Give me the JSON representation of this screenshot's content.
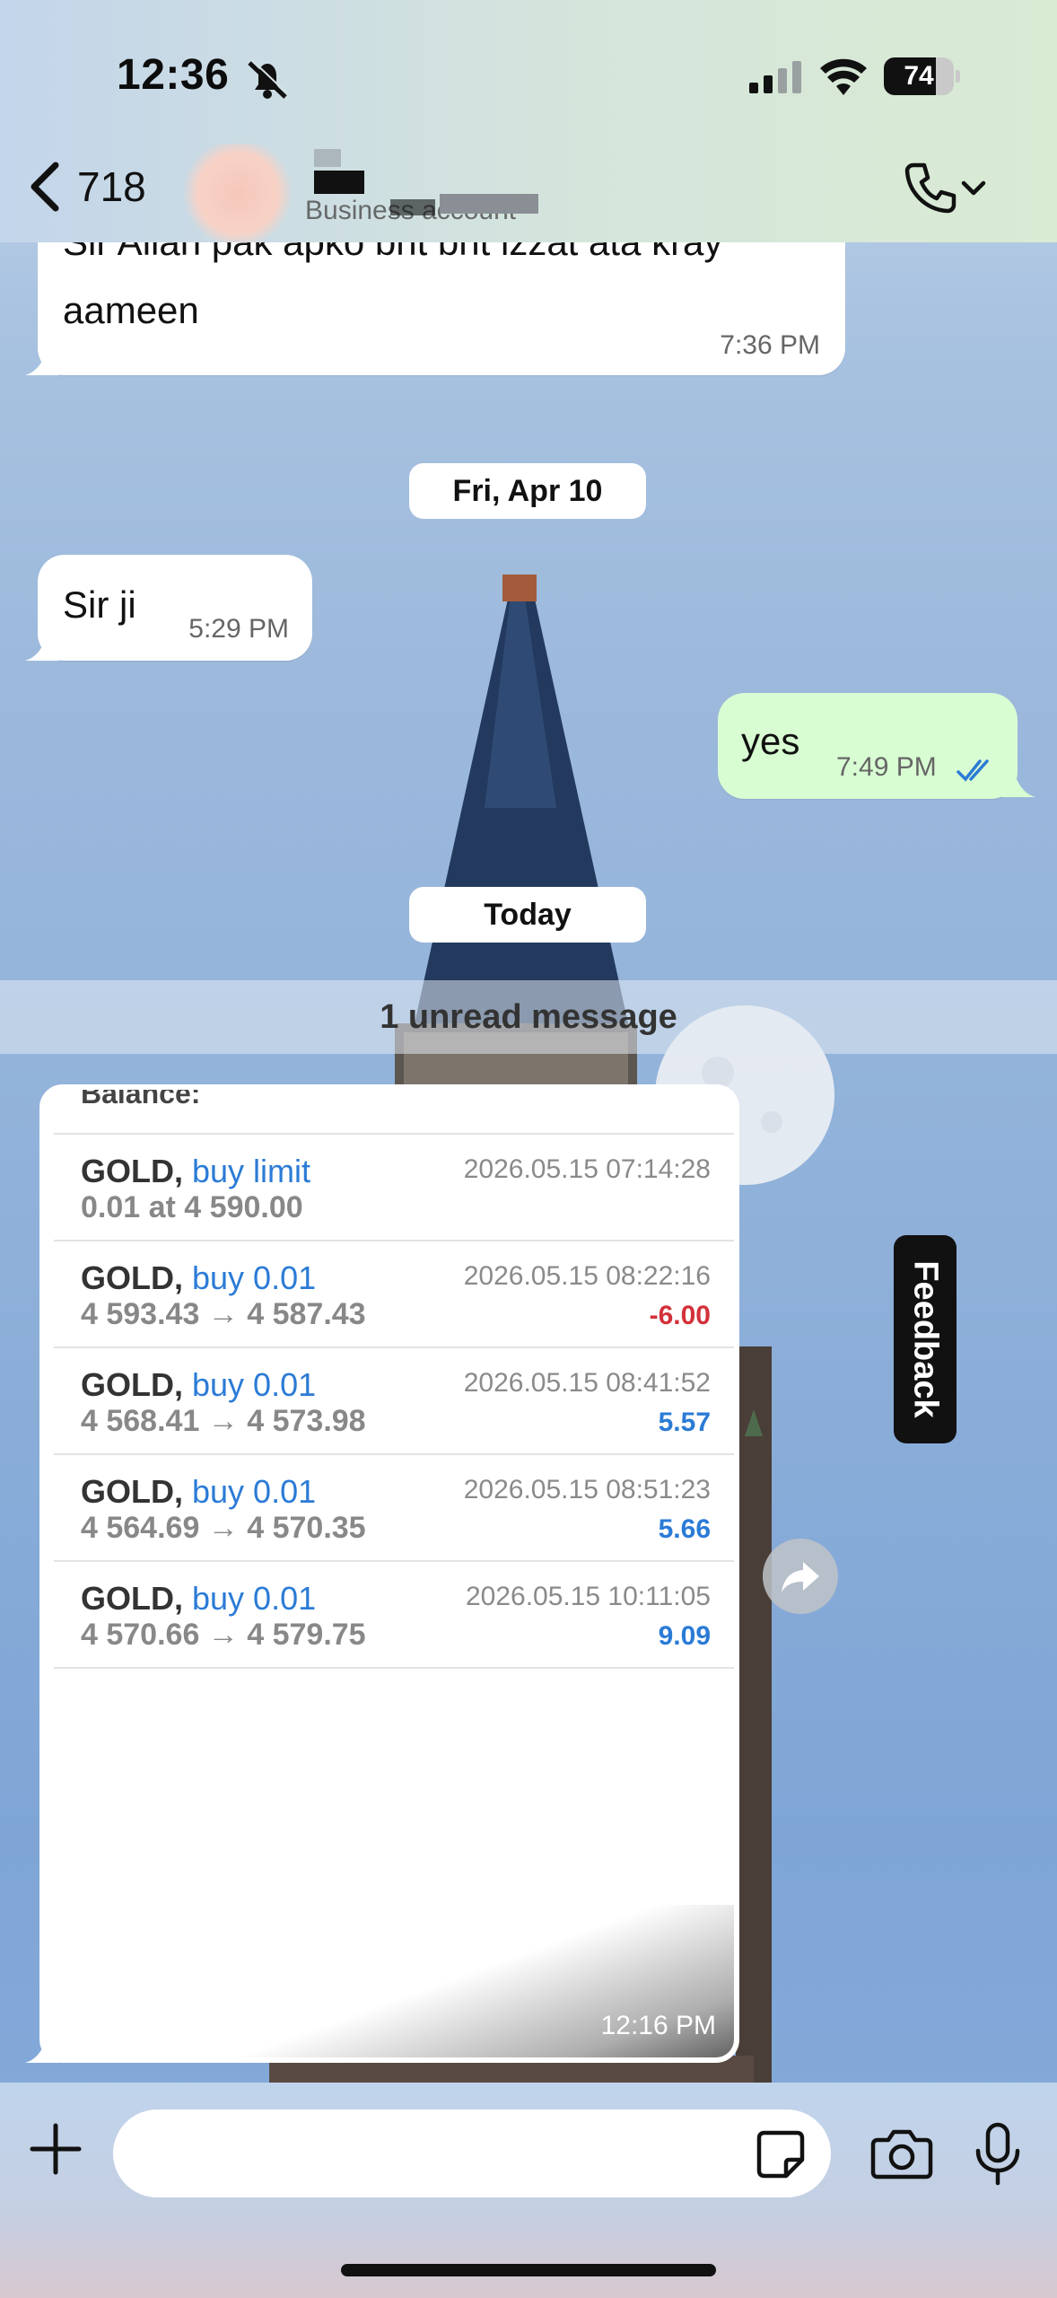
{
  "status_bar": {
    "time": "12:36",
    "battery": "74",
    "battery_level": 0.74
  },
  "header": {
    "back_count": "718",
    "subtitle": "Business account"
  },
  "messages": {
    "msg1": {
      "text_line1": "Sir Allah pak apko bht bht izzat ata kray",
      "text_line2": "aameen",
      "time": "7:36 PM"
    },
    "date1": "Fri, Apr 10",
    "msg2": {
      "text": "Sir ji",
      "time": "5:29 PM"
    },
    "msg3": {
      "text": "yes",
      "time": "7:49 PM"
    },
    "date2": "Today",
    "unread": "1 unread message",
    "image_msg": {
      "time": "12:16 PM",
      "cut_label": "Balance:",
      "trades": [
        {
          "symbol": "GOLD",
          "side": "buy limit",
          "detail": "0.01 at 4 590.00",
          "date": "2026.05.15 07:14:28",
          "pl": "",
          "pl_sign": ""
        },
        {
          "symbol": "GOLD",
          "side": "buy 0.01",
          "detail": "4 593.43 → 4 587.43",
          "date": "2026.05.15 08:22:16",
          "pl": "-6.00",
          "pl_sign": "neg"
        },
        {
          "symbol": "GOLD",
          "side": "buy 0.01",
          "detail": "4 568.41 → 4 573.98",
          "date": "2026.05.15 08:41:52",
          "pl": "5.57",
          "pl_sign": "pos"
        },
        {
          "symbol": "GOLD",
          "side": "buy 0.01",
          "detail": "4 564.69 → 4 570.35",
          "date": "2026.05.15 08:51:23",
          "pl": "5.66",
          "pl_sign": "pos"
        },
        {
          "symbol": "GOLD",
          "side": "buy 0.01",
          "detail": "4 570.66 → 4 579.75",
          "date": "2026.05.15 10:11:05",
          "pl": "9.09",
          "pl_sign": "pos"
        }
      ]
    }
  },
  "feedback_label": "Feedback",
  "composer": {
    "placeholder": ""
  },
  "colors": {
    "outgoing_bubble": "#d9fdd3",
    "incoming_bubble": "#ffffff",
    "read_ticks": "#2b7bd6",
    "loss": "#d3313a",
    "profit": "#2b7bd6"
  }
}
